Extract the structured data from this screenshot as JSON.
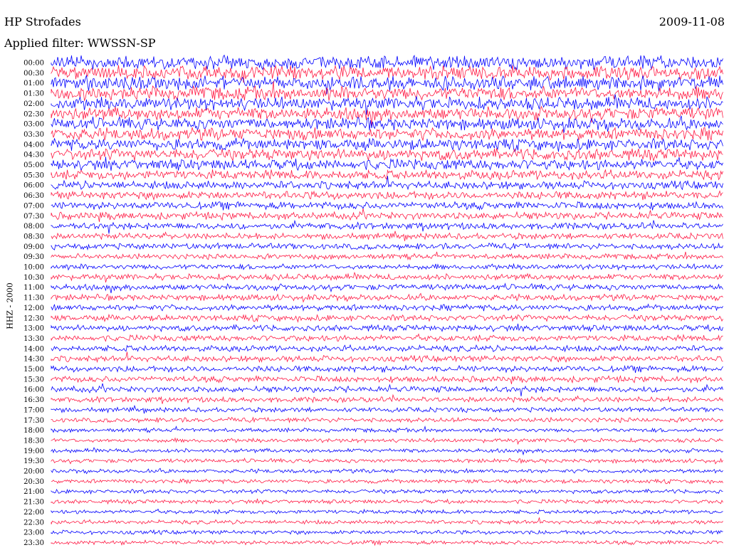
{
  "header": {
    "station": "HP Strofades",
    "date": "2009-11-08",
    "filter": "Applied filter: WWSSN-SP"
  },
  "chart_data": {
    "type": "line",
    "title": "HP Strofades",
    "ylabel": "HHZ - 2000",
    "row_labels": [
      "00:00",
      "00:30",
      "01:00",
      "01:30",
      "02:00",
      "02:30",
      "03:00",
      "03:30",
      "04:00",
      "04:30",
      "05:00",
      "05:30",
      "06:00",
      "06:30",
      "07:00",
      "07:30",
      "08:00",
      "08:30",
      "09:00",
      "09:30",
      "10:00",
      "10:30",
      "11:00",
      "11:30",
      "12:00",
      "12:30",
      "13:00",
      "13:30",
      "14:00",
      "14:30",
      "15:00",
      "15:30",
      "16:00",
      "16:30",
      "17:00",
      "17:30",
      "18:00",
      "18:30",
      "19:00",
      "19:30",
      "20:00",
      "20:30",
      "21:00",
      "21:30",
      "22:00",
      "22:30",
      "23:00",
      "23:30"
    ],
    "trace_colors": [
      "#0000ff",
      "#ff1a44"
    ],
    "relative_amplitude": [
      1.0,
      1.0,
      1.0,
      1.0,
      0.95,
      0.95,
      0.9,
      0.9,
      0.85,
      0.85,
      0.8,
      0.7,
      0.6,
      0.6,
      0.55,
      0.55,
      0.5,
      0.45,
      0.45,
      0.4,
      0.4,
      0.45,
      0.45,
      0.45,
      0.45,
      0.45,
      0.45,
      0.45,
      0.45,
      0.45,
      0.45,
      0.45,
      0.45,
      0.4,
      0.35,
      0.35,
      0.3,
      0.3,
      0.3,
      0.3,
      0.3,
      0.3,
      0.3,
      0.3,
      0.3,
      0.3,
      0.3,
      0.3
    ]
  }
}
